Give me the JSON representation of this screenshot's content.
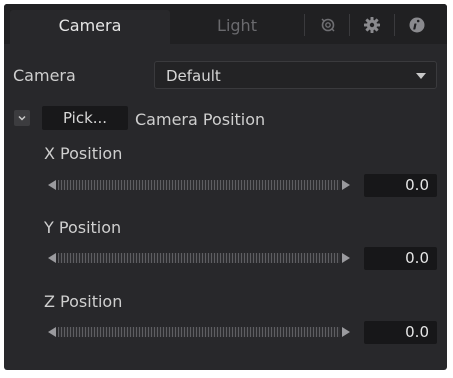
{
  "tabs": {
    "camera_label": "Camera",
    "light_label": "Light",
    "icons": [
      "render-icon",
      "gear-icon",
      "info-icon"
    ]
  },
  "camera": {
    "label": "Camera",
    "selected": "Default"
  },
  "pick": {
    "button_label": "Pick...",
    "section_label": "Camera Position"
  },
  "positions": {
    "x_label": "X Position",
    "x_value": "0.0",
    "y_label": "Y Position",
    "y_value": "0.0",
    "z_label": "Z Position",
    "z_value": "0.0"
  },
  "colors": {
    "panel_bg": "#28282b",
    "tabbar_bg": "#202022",
    "text": "#cfcfcf",
    "field_bg": "#171719"
  }
}
